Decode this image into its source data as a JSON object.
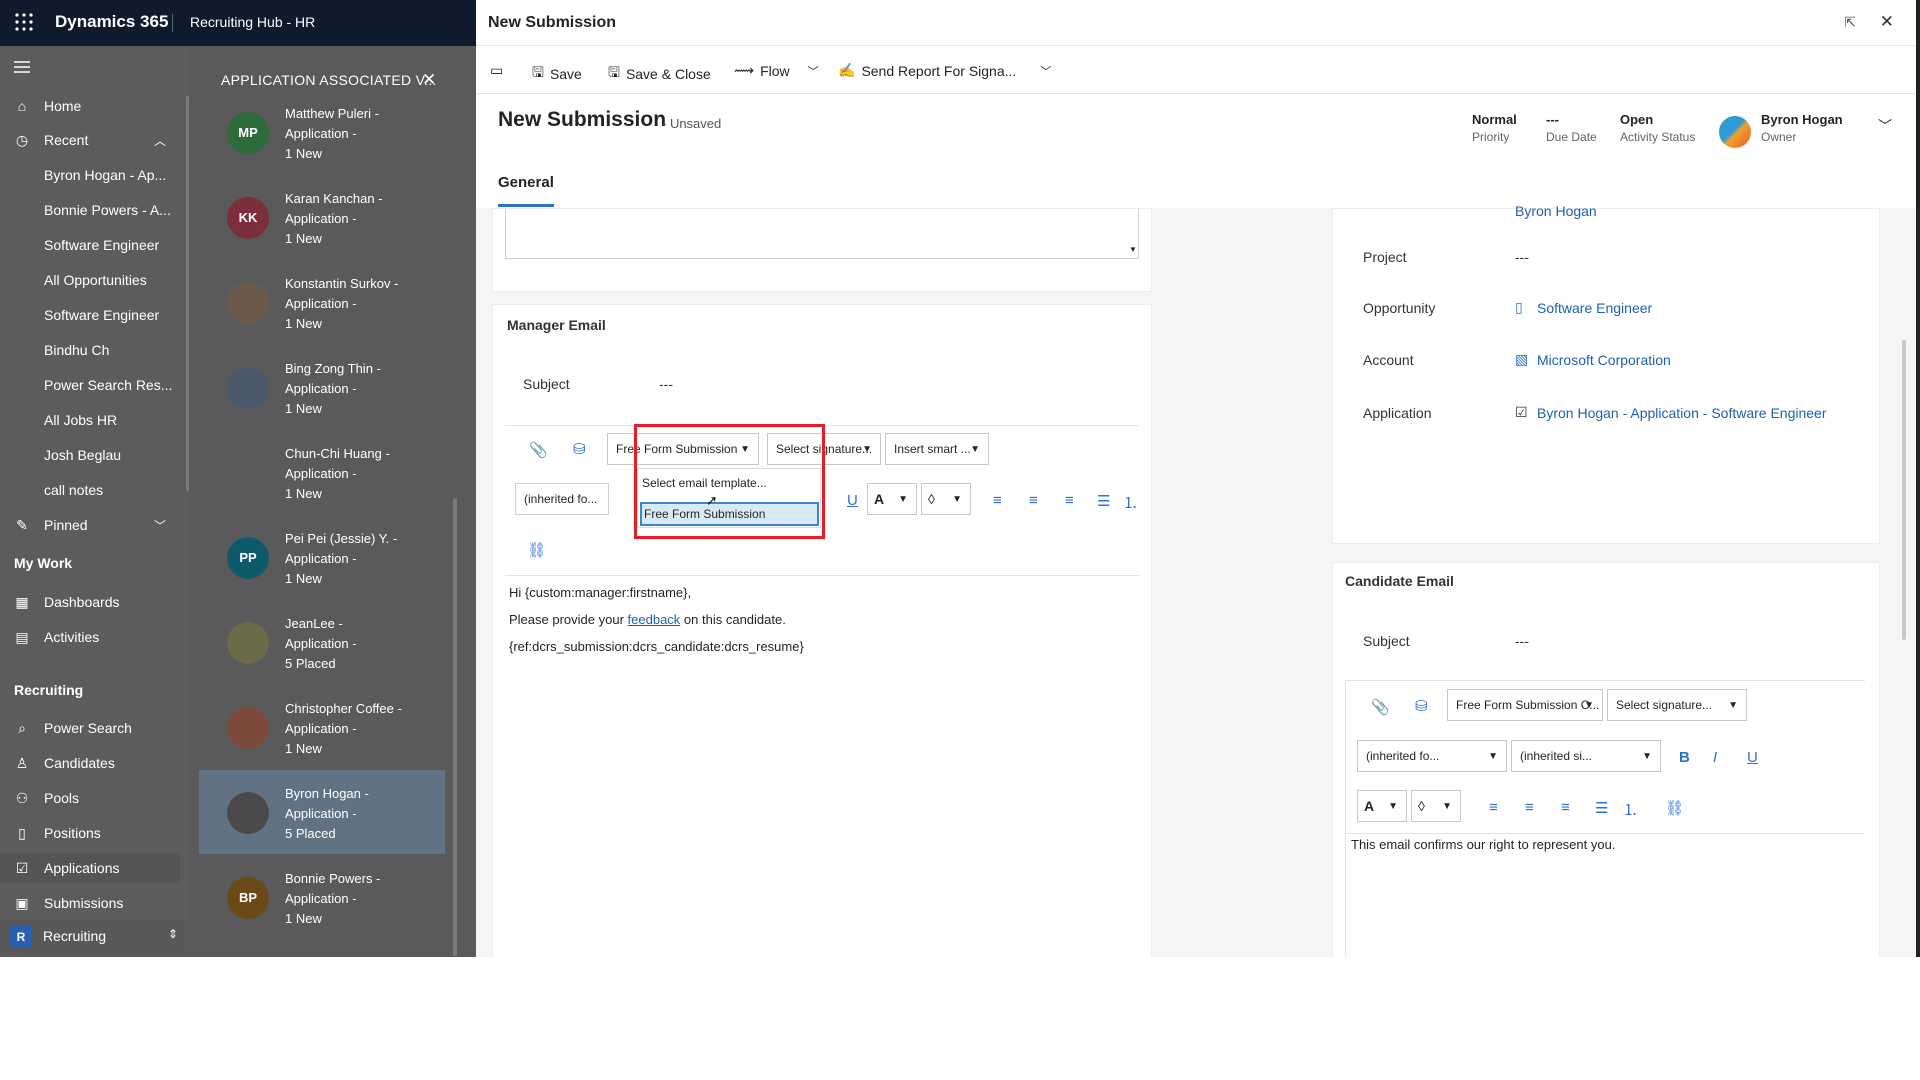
{
  "topbar": {
    "brand": "Dynamics 365",
    "area": "Recruiting Hub - HR"
  },
  "nav": {
    "items": [
      {
        "icon": "home-icon",
        "label": "Home"
      },
      {
        "icon": "clock-icon",
        "label": "Recent"
      }
    ],
    "recent": [
      "Byron Hogan - Ap...",
      "Bonnie Powers - A...",
      "Software Engineer",
      "All Opportunities",
      "Software Engineer",
      "Bindhu Ch",
      "Power Search Res...",
      "All Jobs HR",
      "Josh Beglau",
      "call notes"
    ],
    "pinned": "Pinned",
    "my_work": "My Work",
    "dashboards": "Dashboards",
    "activities": "Activities",
    "recruiting_hdr": "Recruiting",
    "recruiting": [
      "Power Search",
      "Candidates",
      "Pools",
      "Positions",
      "Applications",
      "Submissions"
    ],
    "area_switcher": {
      "badge": "R",
      "label": "Recruiting"
    }
  },
  "mid": {
    "title": "APPLICATION ASSOCIATED V...",
    "cards": [
      {
        "initials": "MP",
        "color": "#2d6b3a",
        "line1": "Matthew Puleri -",
        "line2": "Application -",
        "line3": "1 New"
      },
      {
        "initials": "KK",
        "color": "#7a2f3a",
        "line1": "Karan Kanchan -",
        "line2": "Application -",
        "line3": "1 New"
      },
      {
        "initials": "",
        "color": "#6b5a4a",
        "line1": "Konstantin Surkov -",
        "line2": "Application -",
        "line3": "1 New"
      },
      {
        "initials": "",
        "color": "#4a5a6b",
        "line1": "Bing Zong Thin -",
        "line2": "Application -",
        "line3": "1 New"
      },
      {
        "initials": "",
        "color": "#5a5a5a",
        "line1": "Chun-Chi Huang -",
        "line2": "Application -",
        "line3": "1 New"
      },
      {
        "initials": "PP",
        "color": "#0e5a6b",
        "line1": "Pei Pei (Jessie) Y. -",
        "line2": "Application -",
        "line3": "1 New"
      },
      {
        "initials": "",
        "color": "#6b6b4a",
        "line1": "JeanLee -",
        "line2": "Application -",
        "line3": "5 Placed"
      },
      {
        "initials": "",
        "color": "#7a4a3a",
        "line1": "Christopher Coffee -",
        "line2": "Application -",
        "line3": "1 New"
      },
      {
        "initials": "",
        "color": "#4a4a4a",
        "line1": "Byron Hogan -",
        "line2": "Application -",
        "line3": "5 Placed"
      },
      {
        "initials": "BP",
        "color": "#6b4a1a",
        "line1": "Bonnie Powers -",
        "line2": "Application -",
        "line3": "1 New"
      }
    ]
  },
  "panel": {
    "title": "New Submission",
    "commands": [
      "Save",
      "Save & Close",
      "Flow",
      "Send Report For Signa..."
    ],
    "record_title": "New Submission",
    "unsaved": "- Unsaved",
    "header_fields": [
      {
        "value": "Normal",
        "label": "Priority"
      },
      {
        "value": "---",
        "label": "Due Date"
      },
      {
        "value": "Open",
        "label": "Activity Status"
      }
    ],
    "owner": {
      "value": "Byron Hogan",
      "label": "Owner"
    },
    "tab": "General"
  },
  "manager_email": {
    "title": "Manager Email",
    "subject_label": "Subject",
    "subject_value": "---",
    "template_select": "Free Form Submission",
    "signature_select": "Select signature...",
    "insert_select": "Insert smart ...",
    "font_select": "(inherited fo...",
    "dropdown_options": [
      "Select email template...",
      "Free Form Submission"
    ],
    "body": [
      "Hi {custom:manager:firstname},",
      "Please provide your",
      "feedback",
      "on this candidate.",
      "{ref:dcrs_submission:dcrs_candidate:dcrs_resume}"
    ]
  },
  "right_fields": {
    "partial_top": "Byron Hogan",
    "rows": [
      {
        "label": "Project",
        "value": "---"
      },
      {
        "label": "Opportunity",
        "value": "Software Engineer"
      },
      {
        "label": "Account",
        "value": "Microsoft Corporation"
      },
      {
        "label": "Application",
        "value": "Byron Hogan - Application - Software Engineer"
      }
    ]
  },
  "candidate_email": {
    "title": "Candidate Email",
    "subject_label": "Subject",
    "subject_value": "---",
    "template_select": "Free Form Submission C...",
    "signature_select": "Select signature...",
    "font_select": "(inherited fo...",
    "size_select": "(inherited si...",
    "body": "This email confirms our right to represent you."
  }
}
